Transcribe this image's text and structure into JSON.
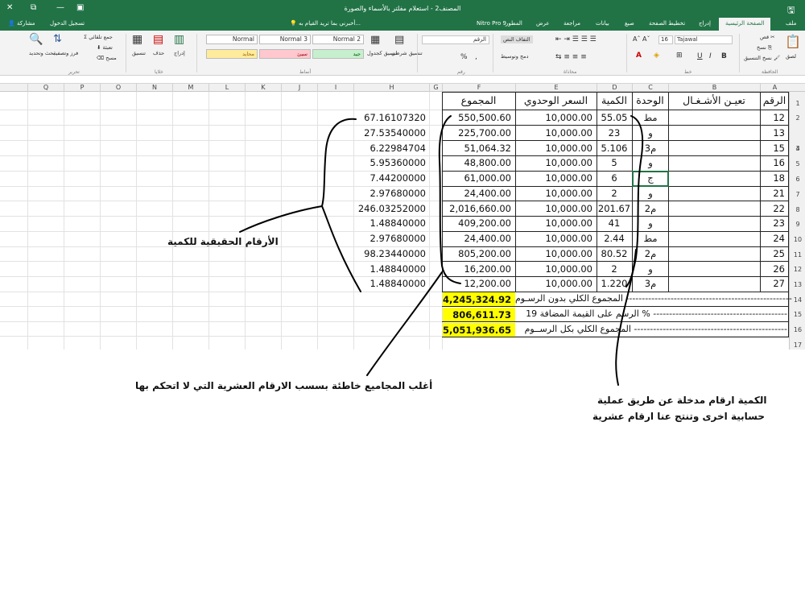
{
  "window": {
    "title": "المصنف2 - استعلام مفلتر بالأسماء والصورة",
    "controls": {
      "close": "✕",
      "restore": "⧉",
      "minimize": "—",
      "ribbon_toggle": "▣"
    }
  },
  "tabs": {
    "file": "ملف",
    "home": "الصفحة الرئيسية",
    "insert": "إدراج",
    "page_layout": "تخطيط الصفحة",
    "formulas": "صيغ",
    "data": "بيانات",
    "review": "مراجعة",
    "view": "عرض",
    "developer": "المطور",
    "nitro": "Nitro Pro 9",
    "tell_me": "أخبرني بما تريد القيام به...",
    "sign_in": "تسجيل الدخول",
    "share": "مشاركة"
  },
  "ribbon": {
    "clipboard": {
      "label": "الحافظة",
      "paste": "لصق",
      "cut": "قص",
      "copy": "نسخ",
      "format_painter": "نسخ التنسيق"
    },
    "font": {
      "label": "خط",
      "name": "Tajawal",
      "size": "16",
      "bold": "B",
      "italic": "I",
      "underline": "U"
    },
    "alignment": {
      "label": "محاذاة",
      "wrap": "التفاف النص",
      "merge": "دمج وتوسيط"
    },
    "number": {
      "label": "رقم",
      "format": "الرقم",
      "percent": "%",
      "comma": ","
    },
    "styles": {
      "label": "أنماط",
      "conditional": "تنسيق شرطي",
      "format_table": "تنسيق كجدول",
      "normal": "Normal",
      "normal2": "Normal 2",
      "normal3": "Normal 3",
      "good": "جيد",
      "bad": "سيئ",
      "neutral": "محايد"
    },
    "cells": {
      "label": "خلايا",
      "insert": "إدراج",
      "delete": "حذف",
      "format": "تنسيق"
    },
    "editing": {
      "label": "تحرير",
      "autosum": "جمع تلقائي",
      "fill": "تعبئة",
      "clear": "مسح",
      "sort": "فرز وتصفية",
      "find": "بحث وتحديد"
    }
  },
  "columns": [
    "A",
    "B",
    "C",
    "D",
    "E",
    "F",
    "G",
    "H",
    "I",
    "J",
    "K",
    "L",
    "M",
    "N",
    "O",
    "P",
    "Q"
  ],
  "rows": [
    "1",
    "2",
    "3",
    "4",
    "5",
    "6",
    "7",
    "8",
    "9",
    "10",
    "11",
    "12",
    "13",
    "14",
    "15",
    "16",
    "17"
  ],
  "table": {
    "headers": {
      "num": "الرقم",
      "work": "تعيـن الأشـغـال",
      "unit": "الوحدة",
      "qty": "الكمية",
      "price": "السعر الوحدوي",
      "total": "المجموع"
    },
    "rows": [
      {
        "num": "12",
        "unit": "مط",
        "qty": "55.05",
        "price": "10,000.00",
        "total": "550,500.60",
        "actual": "67.16107320"
      },
      {
        "num": "13",
        "unit": "و",
        "qty": "23",
        "price": "10,000.00",
        "total": "225,700.00",
        "actual": "27.53540000"
      },
      {
        "num": "15",
        "unit": "م3",
        "qty": "5.106",
        "price": "10,000.00",
        "total": "51,064.32",
        "actual": "6.22984704"
      },
      {
        "num": "16",
        "unit": "و",
        "qty": "5",
        "price": "10,000.00",
        "total": "48,800.00",
        "actual": "5.95360000"
      },
      {
        "num": "18",
        "unit": "ج",
        "qty": "6",
        "price": "10,000.00",
        "total": "61,000.00",
        "actual": "7.44200000"
      },
      {
        "num": "21",
        "unit": "و",
        "qty": "2",
        "price": "10,000.00",
        "total": "24,400.00",
        "actual": "2.97680000"
      },
      {
        "num": "22",
        "unit": "م2",
        "qty": "201.67",
        "price": "10,000.00",
        "total": "2,016,660.00",
        "actual": "246.03252000"
      },
      {
        "num": "23",
        "unit": "و",
        "qty": "41",
        "price": "10,000.00",
        "total": "409,200.00",
        "actual": "1.48840000"
      },
      {
        "num": "24",
        "unit": "مط",
        "qty": "2.44",
        "price": "10,000.00",
        "total": "24,400.00",
        "actual": "2.97680000"
      },
      {
        "num": "25",
        "unit": "م2",
        "qty": "80.52",
        "price": "10,000.00",
        "total": "805,200.00",
        "actual": "98.23440000"
      },
      {
        "num": "26",
        "unit": "و",
        "qty": "2",
        "price": "10,000.00",
        "total": "16,200.00",
        "actual": "1.48840000"
      },
      {
        "num": "27",
        "unit": "م3",
        "qty": "1.220",
        "price": "10,000.00",
        "total": "12,200.00",
        "actual": "1.48840000"
      }
    ],
    "summary": [
      {
        "label": "المجموع الكلي بدون الرسـوم ----------------------------------------------------",
        "value": "4,245,324.92"
      },
      {
        "label": "الرسم على القيمة المضافة 19 % ------------------------------------------",
        "value": "806,611.73"
      },
      {
        "label": "المجموع الكلي بكل الرســوم ------------------------------------------------",
        "value": "5,051,936.65"
      }
    ]
  },
  "annotations": {
    "real_numbers": "الأرقام الحقيقية للكمية",
    "wrong_totals": "أغلب المجاميع خاطئة بسسب الارقام العشرية التي لا اتحكم بها",
    "qty_note_1": "الكمية ارقام مدخلة عن طريق عملية",
    "qty_note_2": "حسابية اخرى وتنتج عنا ارقام عشرية"
  },
  "colors": {
    "excel_green": "#217346",
    "highlight": "#ffff00",
    "good": "#c6efce",
    "bad": "#ffc7ce",
    "neutral": "#ffeb9c"
  }
}
